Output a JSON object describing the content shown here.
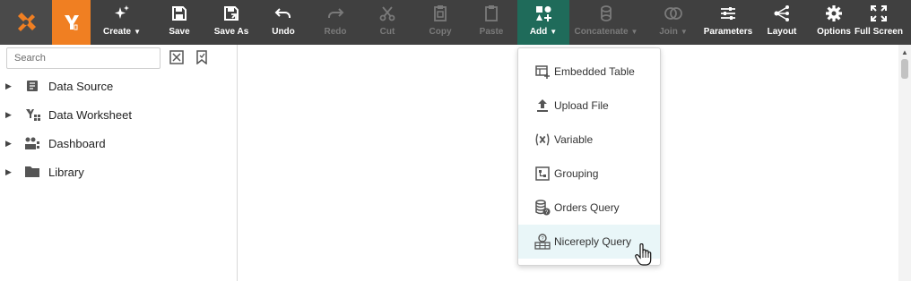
{
  "colors": {
    "toolbar_bg": "#404040",
    "brand_orange": "#f07f22",
    "active_tab": "#1f6b5a",
    "hover_item": "#e9f6f8"
  },
  "toolbar": {
    "create": "Create",
    "save": "Save",
    "save_as": "Save As",
    "undo": "Undo",
    "redo": "Redo",
    "cut": "Cut",
    "copy": "Copy",
    "paste": "Paste",
    "add": "Add",
    "concatenate": "Concatenate",
    "join": "Join",
    "parameters": "Parameters",
    "layout": "Layout",
    "options": "Options",
    "full_screen": "Full Screen"
  },
  "sidebar": {
    "search_placeholder": "Search",
    "items": [
      {
        "label": "Data Source",
        "icon": "data-source-icon"
      },
      {
        "label": "Data Worksheet",
        "icon": "data-worksheet-icon"
      },
      {
        "label": "Dashboard",
        "icon": "dashboard-icon"
      },
      {
        "label": "Library",
        "icon": "folder-icon"
      }
    ]
  },
  "add_menu": {
    "items": [
      {
        "label": "Embedded Table",
        "icon": "embedded-table-icon"
      },
      {
        "label": "Upload File",
        "icon": "upload-icon"
      },
      {
        "label": "Variable",
        "icon": "variable-icon"
      },
      {
        "label": "Grouping",
        "icon": "grouping-icon"
      },
      {
        "label": "Orders Query",
        "icon": "query-icon"
      },
      {
        "label": "Nicereply Query",
        "icon": "tabular-query-icon"
      }
    ]
  }
}
